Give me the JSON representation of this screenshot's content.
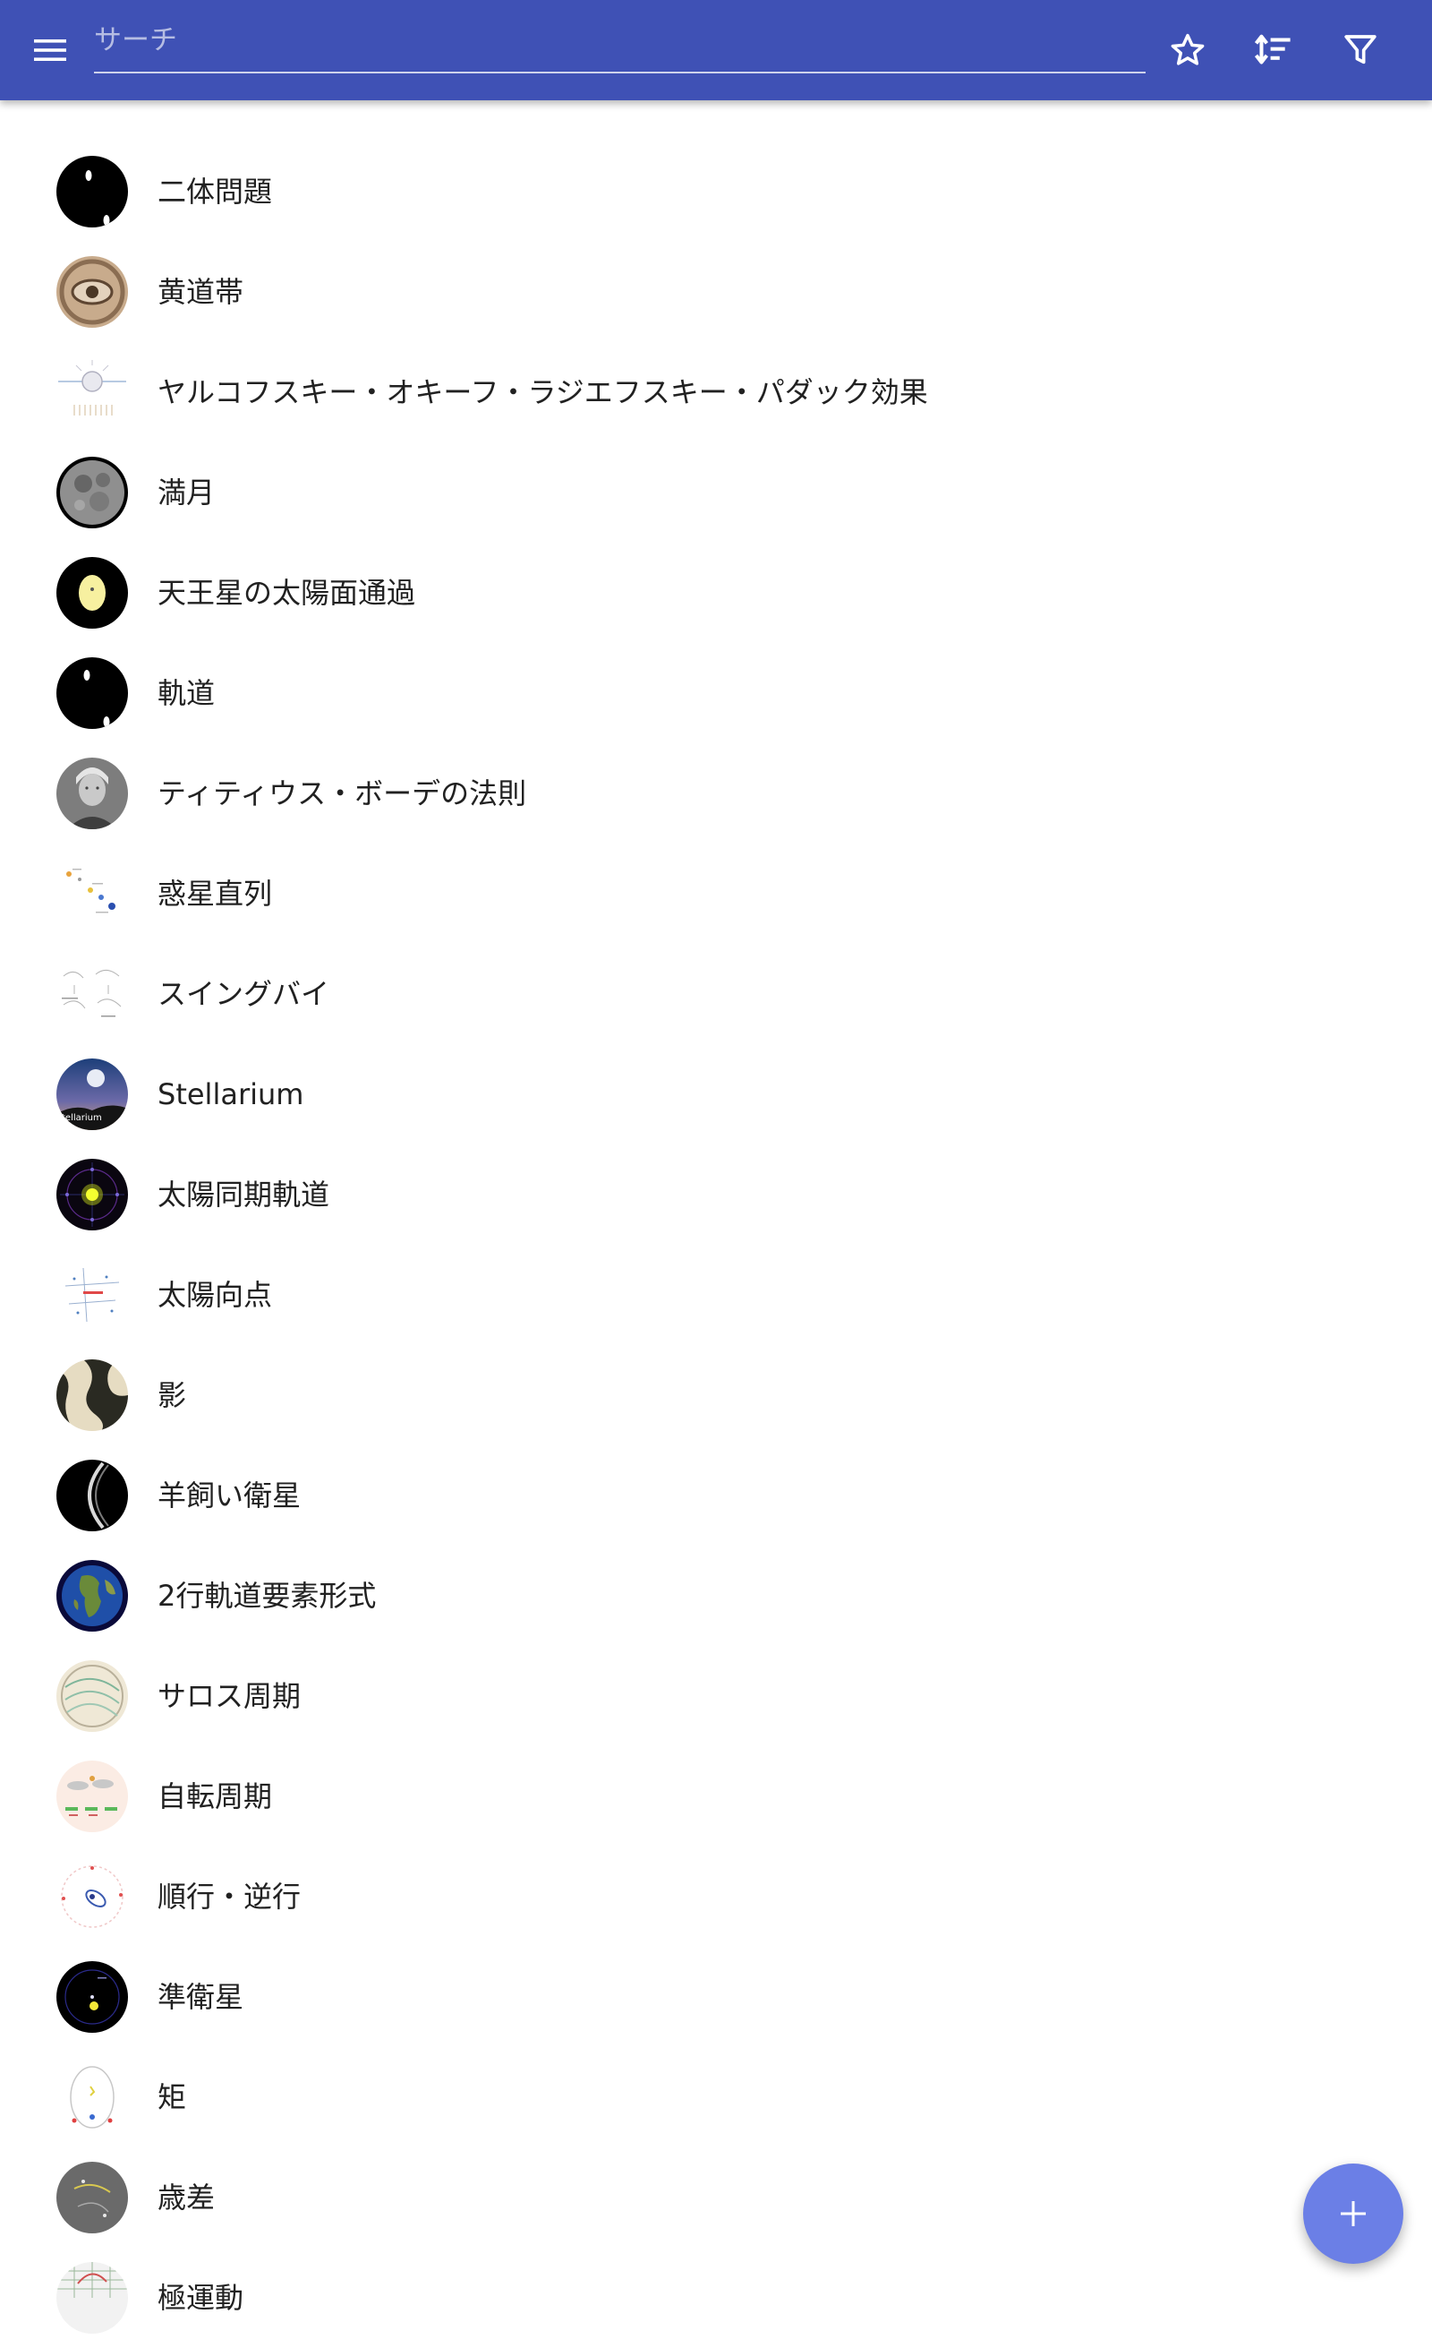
{
  "app_bar": {
    "background_color": "#3f51b5",
    "menu_icon": "hamburger-menu-icon",
    "search": {
      "placeholder": "サーチ",
      "value": ""
    },
    "actions": [
      {
        "name": "favorites",
        "icon": "star-outline-icon"
      },
      {
        "name": "sort",
        "icon": "sort-icon"
      },
      {
        "name": "filter",
        "icon": "filter-icon"
      }
    ]
  },
  "list": {
    "items": [
      {
        "label": "二体問題",
        "thumbnail": "two-body-problem-thumbnail"
      },
      {
        "label": "黄道帯",
        "thumbnail": "zodiac-thumbnail"
      },
      {
        "label": "ヤルコフスキー・オキーフ・ラジエフスキー・パダック効果",
        "thumbnail": "yorp-effect-thumbnail"
      },
      {
        "label": "満月",
        "thumbnail": "full-moon-thumbnail"
      },
      {
        "label": "天王星の太陽面通過",
        "thumbnail": "uranus-transit-thumbnail"
      },
      {
        "label": "軌道",
        "thumbnail": "orbit-thumbnail"
      },
      {
        "label": "ティティウス・ボーデの法則",
        "thumbnail": "titius-bode-portrait-thumbnail"
      },
      {
        "label": "惑星直列",
        "thumbnail": "planetary-alignment-thumbnail"
      },
      {
        "label": "スイングバイ",
        "thumbnail": "swing-by-thumbnail"
      },
      {
        "label": "Stellarium",
        "thumbnail": "stellarium-logo-thumbnail",
        "thumbnail_text": "tellarium"
      },
      {
        "label": "太陽同期軌道",
        "thumbnail": "sun-synchronous-orbit-thumbnail"
      },
      {
        "label": "太陽向点",
        "thumbnail": "solar-apex-thumbnail"
      },
      {
        "label": "影",
        "thumbnail": "shadow-thumbnail"
      },
      {
        "label": "羊飼い衛星",
        "thumbnail": "shepherd-moon-thumbnail"
      },
      {
        "label": "2行軌道要素形式",
        "thumbnail": "earth-globe-thumbnail"
      },
      {
        "label": "サロス周期",
        "thumbnail": "saros-cycle-thumbnail"
      },
      {
        "label": "自転周期",
        "thumbnail": "rotation-period-thumbnail"
      },
      {
        "label": "順行・逆行",
        "thumbnail": "prograde-retrograde-thumbnail"
      },
      {
        "label": "準衛星",
        "thumbnail": "quasi-satellite-thumbnail"
      },
      {
        "label": "矩",
        "thumbnail": "quadrature-thumbnail"
      },
      {
        "label": "歳差",
        "thumbnail": "precession-thumbnail"
      },
      {
        "label": "極運動",
        "thumbnail": "polar-motion-thumbnail"
      }
    ]
  },
  "fab": {
    "icon": "plus-icon",
    "color": "#6b7fe6"
  }
}
